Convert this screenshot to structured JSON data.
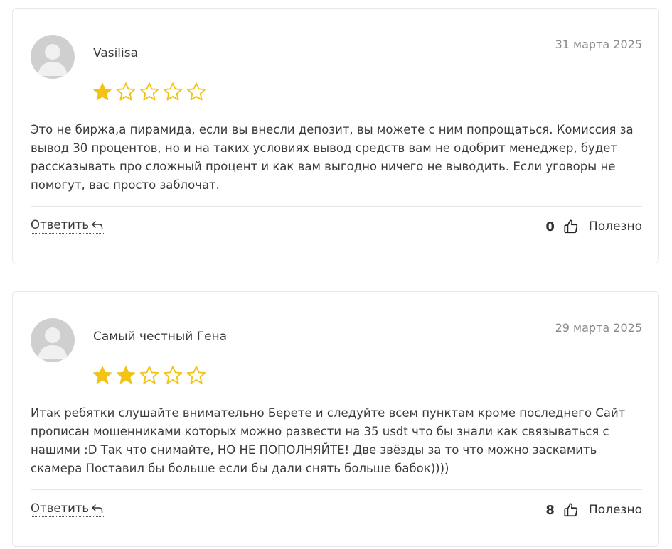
{
  "colors": {
    "star_filled": "#f2c314",
    "star_outline": "#f2c314",
    "avatar_bg": "#cfcfcf",
    "avatar_figure": "#f0f0f0"
  },
  "reviews": [
    {
      "author": "Vasilisa",
      "date": "31 марта 2025",
      "rating": 1,
      "rating_max": 5,
      "text": "Это не биржа,а пирамида, если вы внесли депозит, вы можете с ним попрощаться. Комиссия за вывод 30 процентов, но и на таких условиях вывод средств вам не одобрит менеджер, будет рассказывать про сложный процент и как вам выгодно ничего не выводить. Если уговоры не помогут, вас просто заблочат.",
      "reply_label": "Ответить",
      "useful_count": "0",
      "useful_label": "Полезно",
      "icons": {
        "avatar": "user-avatar-icon",
        "reply": "reply-arrow-icon",
        "like": "thumbs-up-icon"
      }
    },
    {
      "author": "Самый честный Гена",
      "date": "29 марта 2025",
      "rating": 2,
      "rating_max": 5,
      "text": "Итак ребятки слушайте внимательно Берете и следуйте всем пунктам кроме последнего Сайт прописан мошенниками которых можно развести на 35 usdt что бы знали как связываться с нашими :D Так что снимайте, НО НЕ ПОПОЛНЯЙТЕ! Две звёзды за то что можно заскамить скамера Поставил бы больше если бы дали снять больше бабок))))",
      "reply_label": "Ответить",
      "useful_count": "8",
      "useful_label": "Полезно",
      "icons": {
        "avatar": "user-avatar-icon",
        "reply": "reply-arrow-icon",
        "like": "thumbs-up-icon"
      }
    }
  ]
}
